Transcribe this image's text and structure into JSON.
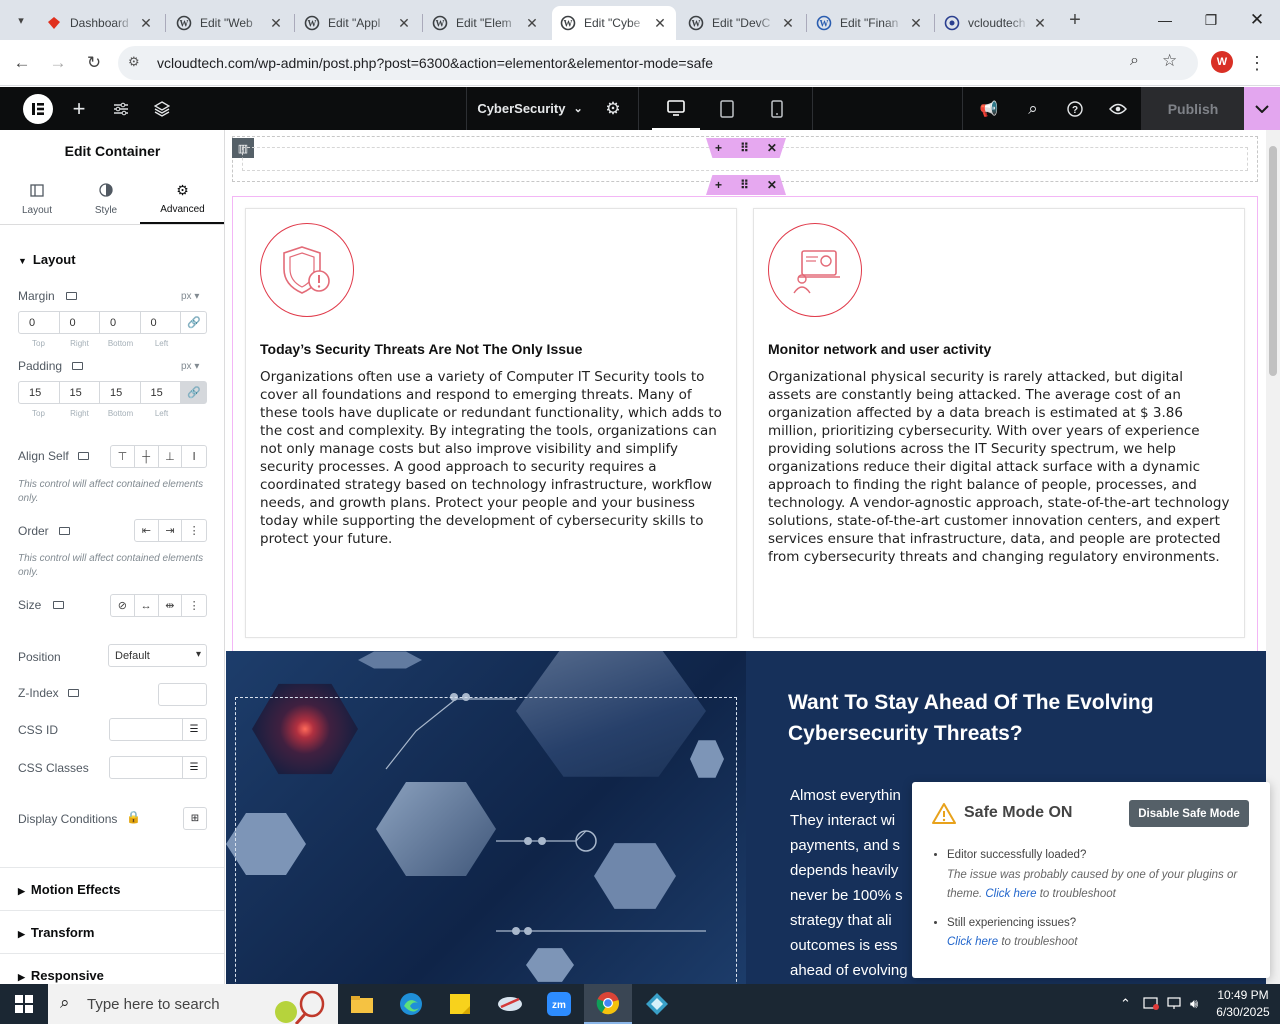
{
  "browser": {
    "tabs": [
      {
        "label": "Dashboard",
        "icon": "ruby-icon"
      },
      {
        "label": "Edit \"Web",
        "icon": "wordpress-icon"
      },
      {
        "label": "Edit \"Appl",
        "icon": "wordpress-icon"
      },
      {
        "label": "Edit \"Elem",
        "icon": "wordpress-icon"
      },
      {
        "label": "Edit \"Cybe",
        "icon": "wordpress-icon"
      },
      {
        "label": "Edit \"DevC",
        "icon": "wordpress-icon"
      },
      {
        "label": "Edit \"Finan",
        "icon": "wordpress-icon"
      },
      {
        "label": "vcloudtech",
        "icon": "site-icon"
      }
    ],
    "active_tab": 4,
    "url": "vcloudtech.com/wp-admin/post.php?post=6300&action=elementor&elementor-mode=safe",
    "profile_initial": "W"
  },
  "editor": {
    "page_name": "CyberSecurity",
    "publish_label": "Publish"
  },
  "panel": {
    "title": "Edit Container",
    "tabs": [
      "Layout",
      "Style",
      "Advanced"
    ],
    "section_layout": "Layout",
    "margin_label": "Margin",
    "margin_unit": "px",
    "margin_values": [
      "0",
      "0",
      "0",
      "0"
    ],
    "padding_label": "Padding",
    "padding_unit": "px",
    "padding_values": [
      "15",
      "15",
      "15",
      "15"
    ],
    "dim_labels": [
      "Top",
      "Right",
      "Bottom",
      "Left"
    ],
    "align_self_label": "Align Self",
    "align_note": "This control will affect contained elements only.",
    "order_label": "Order",
    "order_note": "This control will affect contained elements only.",
    "size_label": "Size",
    "position_label": "Position",
    "position_value": "Default",
    "zindex_label": "Z-Index",
    "cssid_label": "CSS ID",
    "cssclasses_label": "CSS Classes",
    "display_conditions_label": "Display Conditions",
    "motion_effects": "Motion Effects",
    "transform": "Transform",
    "responsive": "Responsive"
  },
  "cards": [
    {
      "title": "Today’s Security Threats Are Not The Only Issue",
      "text": "Organizations often use a variety of Computer IT Security tools to cover all foundations and respond to emerging threats. Many of these tools have duplicate or redundant functionality, which adds to the cost and complexity. By integrating the tools, organizations can not only manage costs but also improve visibility and simplify security processes. A good approach to security requires a coordinated strategy based on technology infrastructure, workflow needs, and growth plans. Protect your people and your business today while supporting the development of cybersecurity skills to protect your future."
    },
    {
      "title": "Monitor network and user activity",
      "text": "Organizational physical security is rarely attacked, but digital assets are constantly being attacked. The average cost of an organization affected by a data breach is estimated at $ 3.86 million, prioritizing cybersecurity. With over years of experience providing solutions across the IT Security spectrum, we help organizations reduce their digital attack surface with a dynamic approach to finding the right balance of people, processes, and technology. A vendor-agnostic approach, state-of-the-art technology solutions, state-of-the-art customer innovation centers, and expert services ensure that infrastructure, data, and people are protected from cybersecurity threats and changing regulatory environments."
    }
  ],
  "dark_section": {
    "heading": "Want To Stay Ahead Of The Evolving Cybersecurity Threats?",
    "lines": [
      "Almost everythin",
      "They interact wi",
      "payments, and s",
      "depends heavily",
      "never be 100% s",
      "strategy that ali",
      "outcomes is ess",
      "ahead of evolving cyber threats. In addition to helping define"
    ]
  },
  "safe_mode": {
    "title": "Safe Mode ON",
    "button": "Disable Safe Mode",
    "item1_title": "Editor successfully loaded?",
    "item1_desc": "The issue was probably caused by one of your plugins or theme.",
    "item1_link": "Click here",
    "item1_tail": "to troubleshoot",
    "item2_title": "Still experiencing issues?",
    "item2_link": "Click here",
    "item2_tail": "to troubleshoot"
  },
  "taskbar": {
    "search_placeholder": "Type here to search",
    "time": "10:49 PM",
    "date": "6/30/2025"
  }
}
